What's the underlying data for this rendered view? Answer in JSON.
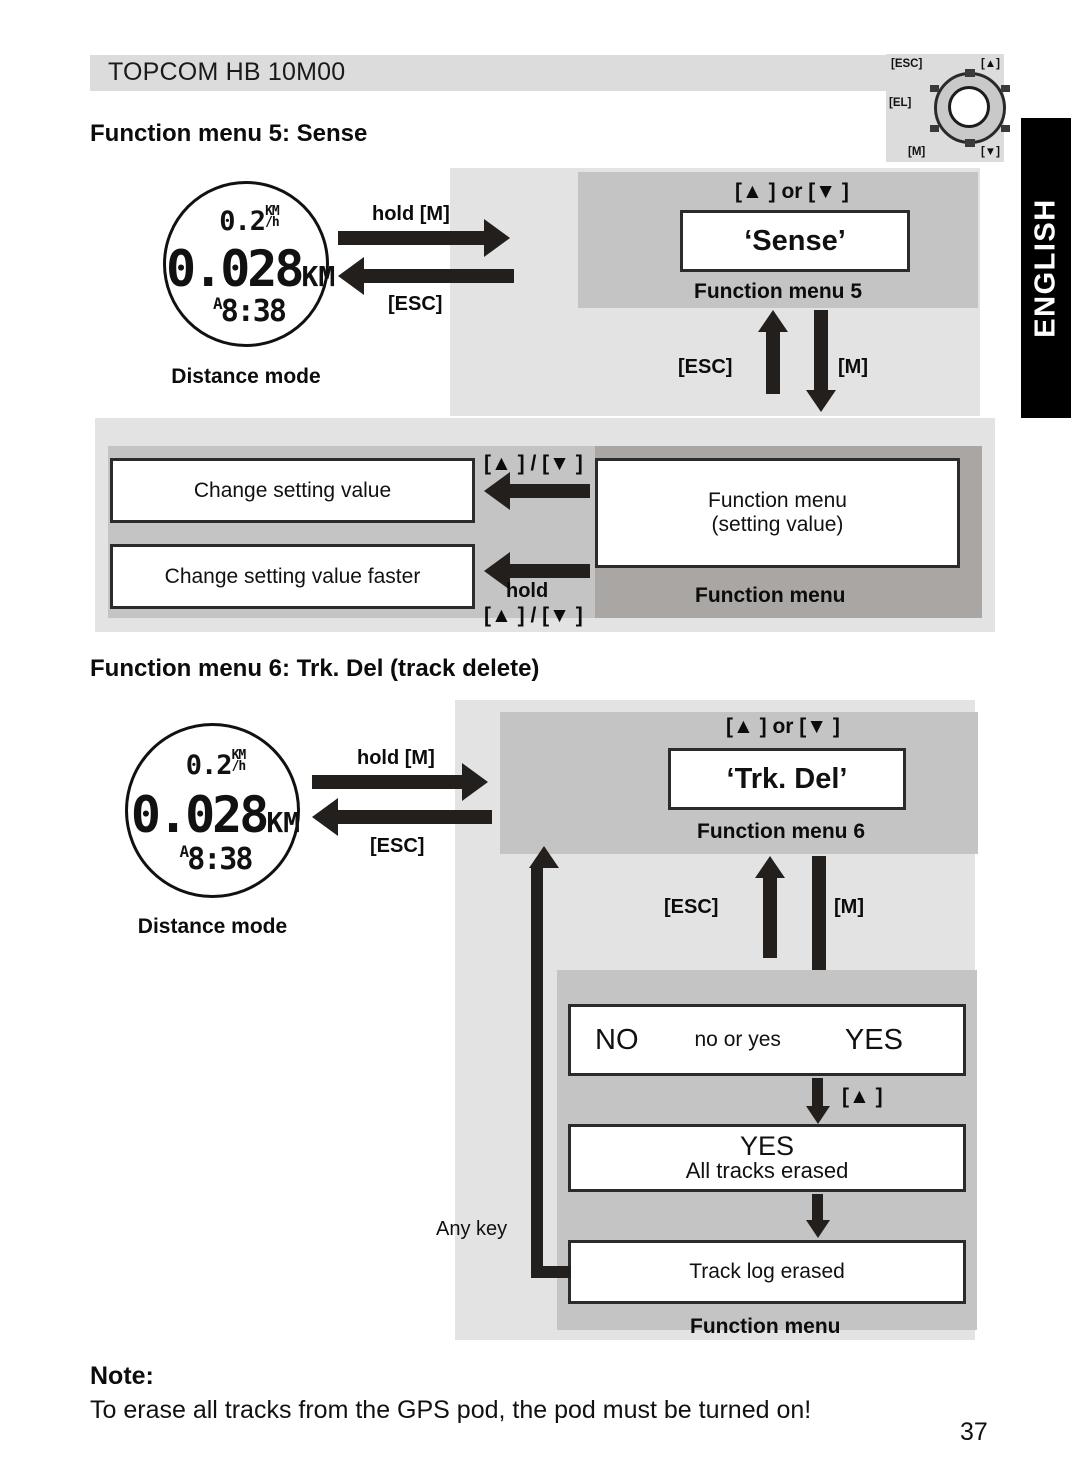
{
  "header": {
    "title": "TOPCOM HB 10M00",
    "page_number": "37"
  },
  "language_tab": {
    "label": "ENGLISH"
  },
  "dial_icon": {
    "esc": "[ESC]",
    "up": "[▲]",
    "el": "[EL]",
    "m": "[M]",
    "down": "[▼]"
  },
  "lcd": {
    "speed_value": "0.2",
    "speed_unit_top": "KM",
    "speed_unit_bottom": "/h",
    "distance_value": "0.028",
    "distance_unit": "KM",
    "time_prefix": "A",
    "time_value": "8:38",
    "caption": "Distance mode"
  },
  "section5": {
    "title": "Function menu 5: Sense",
    "enter_label": "hold [M]",
    "exit_label": "[ESC]",
    "updown_label": "[▲ ] or [▼ ]",
    "menu_box": "‘Sense’",
    "menu_caption": "Function menu 5",
    "esc_label": "[ESC]",
    "m_label": "[M]",
    "setting_box_line1": "Function menu",
    "setting_box_line2": "(setting value)",
    "setting_caption": "Function menu",
    "change_box": "Change setting value",
    "change_faster_box": "Change setting value faster",
    "updown_slash_label": "[▲ ] / [▼ ]",
    "hold_label": "hold",
    "hold_updown_label": "[▲ ] / [▼ ]"
  },
  "section6": {
    "title": "Function menu 6: Trk. Del (track delete)",
    "enter_label": "hold [M]",
    "exit_label": "[ESC]",
    "updown_label": "[▲ ] or [▼ ]",
    "menu_box": "‘Trk. Del’",
    "menu_caption": "Function menu 6",
    "esc_label": "[ESC]",
    "m_label": "[M]",
    "choice_no": "NO",
    "choice_prompt": "no or yes",
    "choice_yes": "YES",
    "up_key_label": "[▲ ]",
    "confirm_title": "YES",
    "confirm_sub": "All tracks erased",
    "erased_box": "Track log erased",
    "menu_caption_bottom": "Function menu",
    "any_key_label": "Any key"
  },
  "note": {
    "heading": "Note:",
    "body": "To erase all tracks from the GPS pod, the pod must be turned on!"
  },
  "colors": {
    "panel_light": "#e3e3e3",
    "panel_mid": "#c4c4c4",
    "panel_warm": "#aaa6a3",
    "header_bar": "#dcdcdc",
    "ink": "#231f1d"
  }
}
